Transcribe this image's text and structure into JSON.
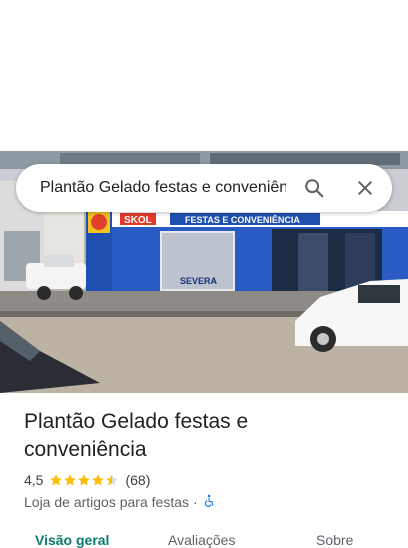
{
  "search": {
    "query": "Plantão Gelado festas e conveniênc",
    "search_icon": "search-icon",
    "close_icon": "close-icon"
  },
  "photo": {
    "description_icon": "storefront-photo",
    "sign_brand": "SKOL",
    "sign_text": "FESTAS E CONVENIÊNCIA",
    "banner_text": "SEVERA"
  },
  "place": {
    "title": "Plantão Gelado festas e conveniência",
    "rating": "4,5",
    "stars_filled": 4.5,
    "review_count": "(68)",
    "category": "Loja de artigos para festas",
    "separator": "·",
    "accessibility_icon": "wheelchair-icon"
  },
  "tabs": [
    {
      "label": "Visão geral",
      "active": true
    },
    {
      "label": "Avaliações",
      "active": false
    },
    {
      "label": "Sobre",
      "active": false
    }
  ],
  "colors": {
    "star": "#fbbc04",
    "accent": "#0b7a6f",
    "accessibility": "#1a73e8"
  }
}
